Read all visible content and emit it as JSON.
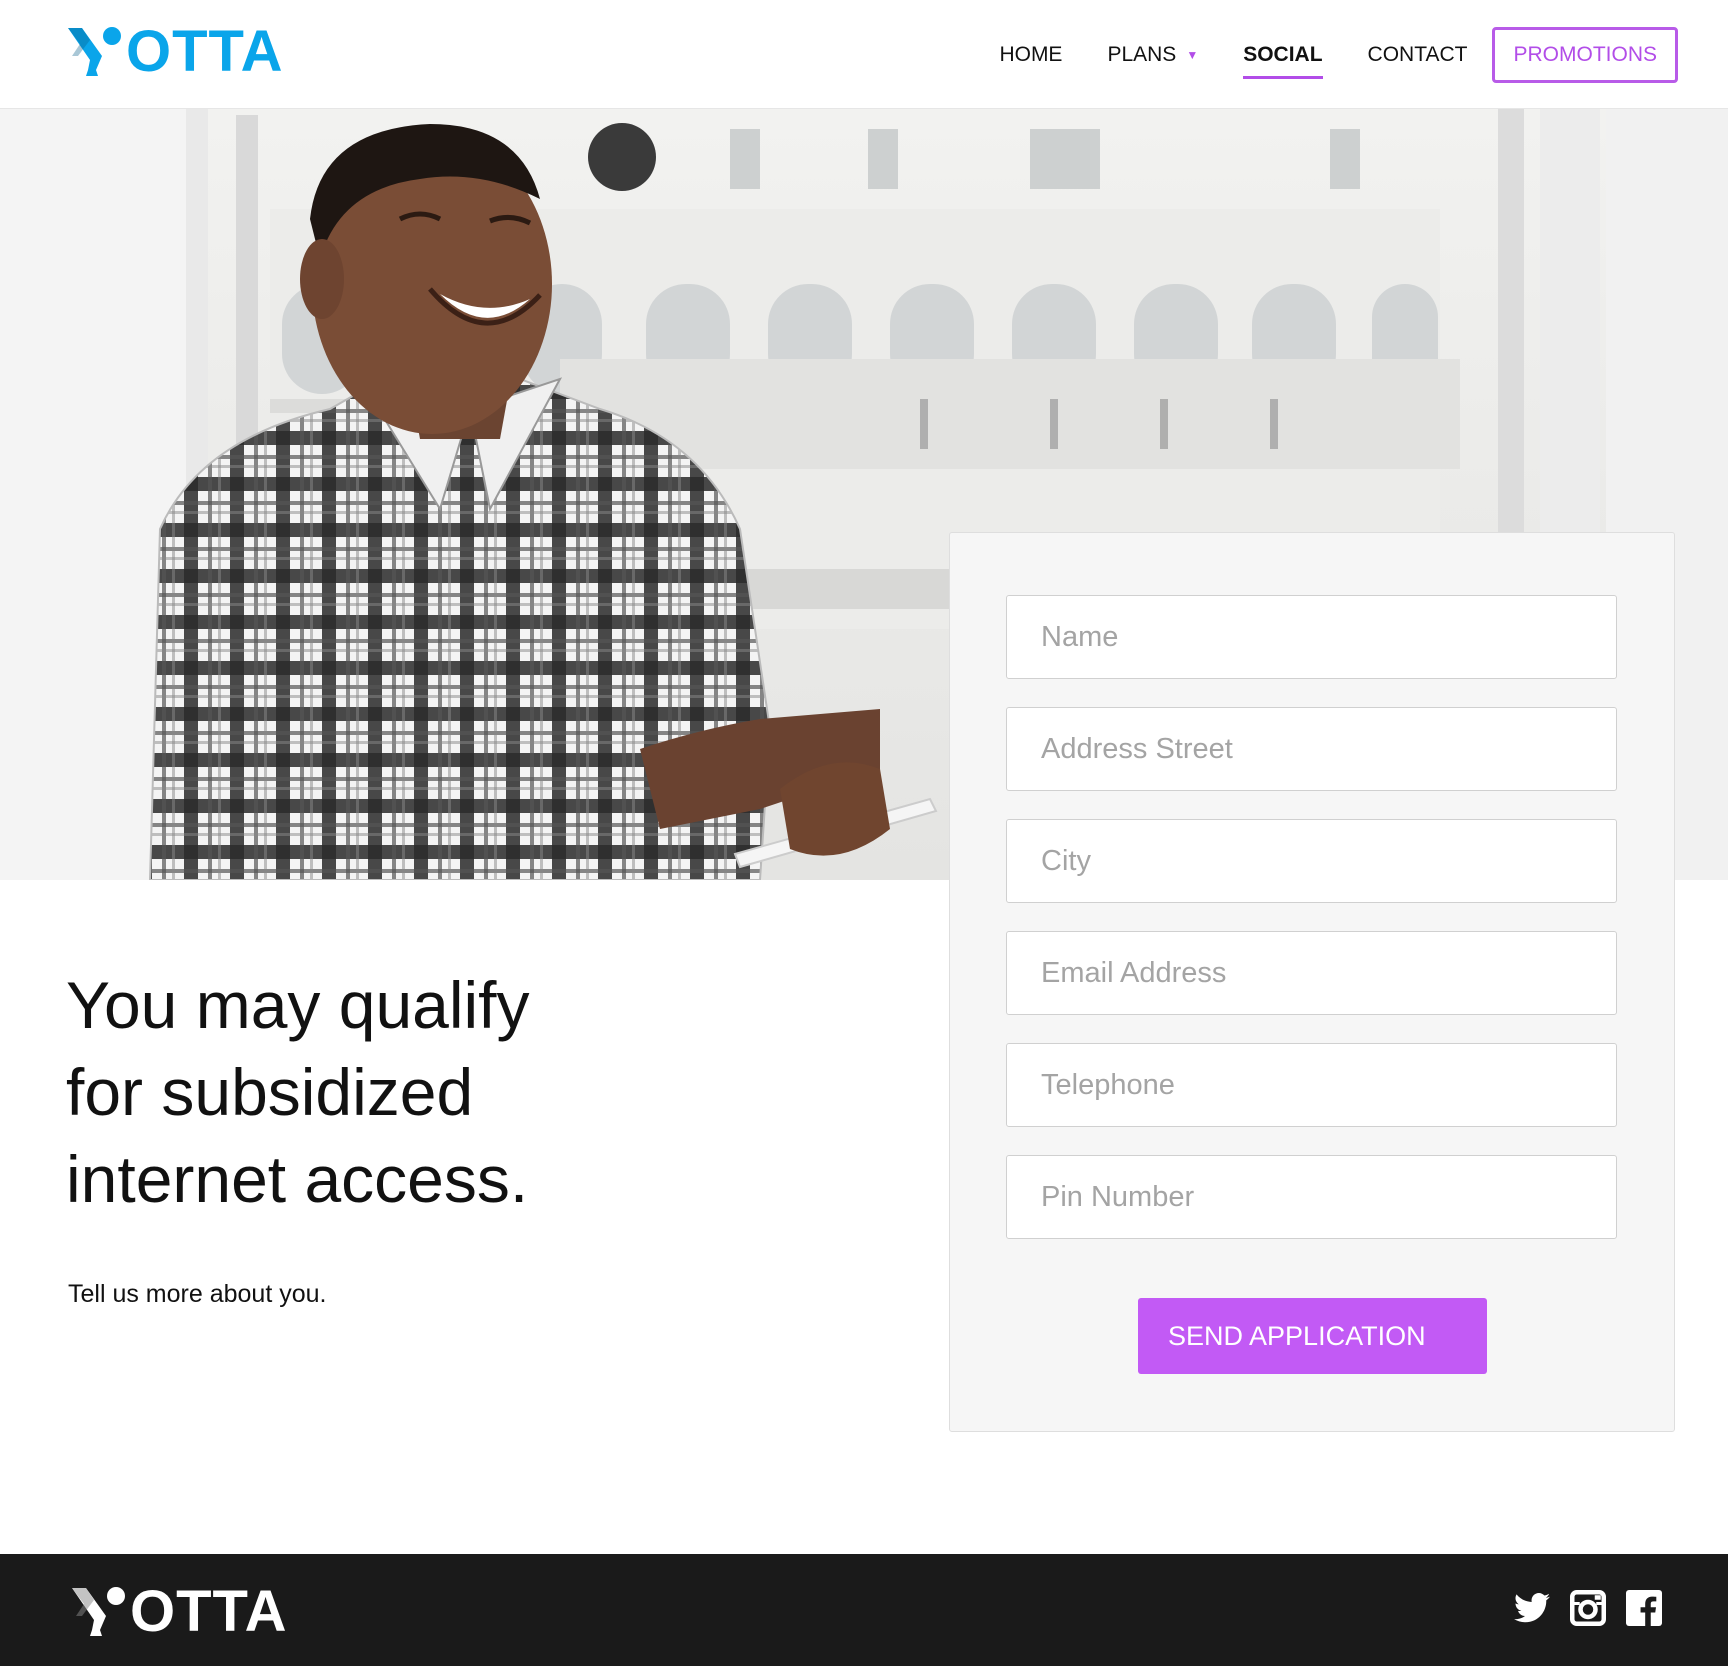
{
  "header": {
    "logo_text": "OTTA",
    "nav": {
      "home": "HOME",
      "plans": "PLANS",
      "social": "SOCIAL",
      "contact": "CONTACT",
      "promotions": "PROMOTIONS"
    },
    "plans_caret_icon": "caret-down-icon",
    "active_item": "SOCIAL"
  },
  "hero": {
    "image": "smiling-man-holding-phone-photo"
  },
  "main": {
    "headline_lines": [
      "You may qualify",
      "for subsidized",
      "internet access."
    ],
    "subtext": "Tell us more about you."
  },
  "form": {
    "fields": {
      "name": {
        "placeholder": "Name",
        "value": ""
      },
      "address": {
        "placeholder": "Address Street",
        "value": ""
      },
      "city": {
        "placeholder": "City",
        "value": ""
      },
      "email": {
        "placeholder": "Email Address",
        "value": ""
      },
      "telephone": {
        "placeholder": "Telephone",
        "value": ""
      },
      "pin": {
        "placeholder": "Pin Number",
        "value": ""
      }
    },
    "submit_label": "SEND APPLICATION"
  },
  "footer": {
    "logo_text": "OTTA",
    "social_icons": [
      "twitter-icon",
      "instagram-icon",
      "facebook-icon"
    ]
  },
  "colors": {
    "brand_blue": "#0aa5ea",
    "accent_purple": "#b24de8",
    "button_purple": "#c25af5",
    "footer_bg": "#1a1a1a"
  }
}
